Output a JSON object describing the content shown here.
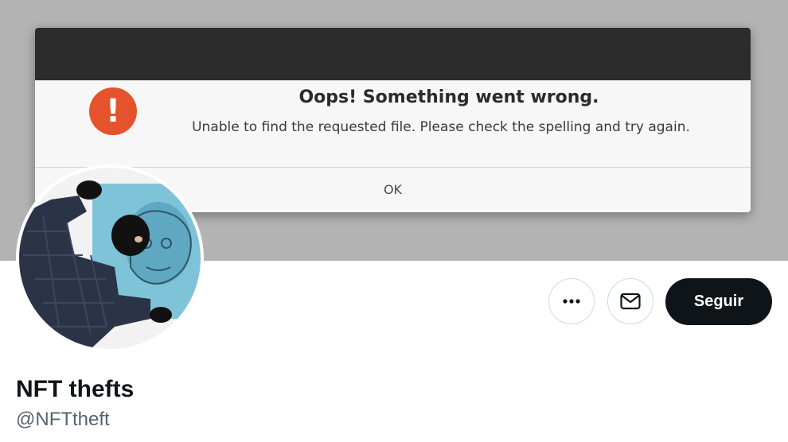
{
  "dialog": {
    "title": "Oops! Something went wrong.",
    "message": "Unable to find the requested file. Please check the spelling and try again.",
    "ok_label": "OK",
    "icon": "error-exclamation-icon",
    "icon_glyph": "!",
    "icon_color": "#e5532d"
  },
  "profile": {
    "name": "NFT thefts",
    "handle": "@NFTtheft",
    "avatar": "profile-photo-thief-stealing-ape-painting"
  },
  "actions": {
    "more_icon": "more-options-icon",
    "message_icon": "envelope-icon",
    "follow_label": "Seguir"
  },
  "colors": {
    "banner": "#b3b3b3",
    "titlebar": "#2c2c2c",
    "follow_bg": "#0f1419",
    "handle_text": "#536471"
  }
}
